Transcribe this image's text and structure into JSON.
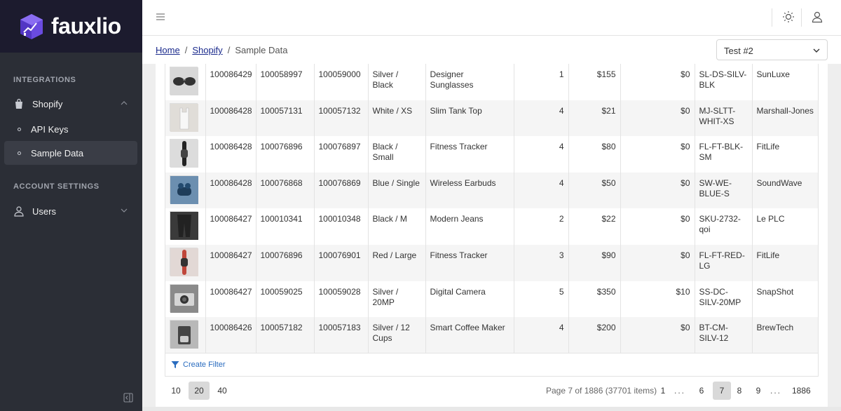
{
  "brand": {
    "name": "fauxlio"
  },
  "sidebar": {
    "section_integrations": "INTEGRATIONS",
    "shopify_label": "Shopify",
    "api_keys_label": "API Keys",
    "sample_data_label": "Sample Data",
    "section_account": "ACCOUNT SETTINGS",
    "users_label": "Users"
  },
  "breadcrumb": {
    "home": "Home",
    "shopify": "Shopify",
    "current": "Sample Data",
    "sep": "/"
  },
  "store_select": {
    "value": "Test #2"
  },
  "rows": [
    {
      "order": "100086429",
      "product": "100058997",
      "variant": "100059000",
      "option": "Silver / Black",
      "title": "Designer Sunglasses",
      "qty": "1",
      "price": "$155",
      "discount": "$0",
      "sku": "SL-DS-SILV-BLK",
      "vendor": "SunLuxe",
      "thumb_color": "#d8d8d8",
      "thumb": "sunglasses"
    },
    {
      "order": "100086428",
      "product": "100057131",
      "variant": "100057132",
      "option": "White / XS",
      "title": "Slim Tank Top",
      "qty": "4",
      "price": "$21",
      "discount": "$0",
      "sku": "MJ-SLTT-WHIT-XS",
      "vendor": "Marshall-Jones",
      "thumb_color": "#e0ddd8",
      "thumb": "tank"
    },
    {
      "order": "100086428",
      "product": "100076896",
      "variant": "100076897",
      "option": "Black / Small",
      "title": "Fitness Tracker",
      "qty": "4",
      "price": "$80",
      "discount": "$0",
      "sku": "FL-FT-BLK-SM",
      "vendor": "FitLife",
      "thumb_color": "#dcdcdc",
      "thumb": "tracker-black"
    },
    {
      "order": "100086428",
      "product": "100076868",
      "variant": "100076869",
      "option": "Blue / Single",
      "title": "Wireless Earbuds",
      "qty": "4",
      "price": "$50",
      "discount": "$0",
      "sku": "SW-WE-BLUE-S",
      "vendor": "SoundWave",
      "thumb_color": "#6c8fb0",
      "thumb": "earbuds"
    },
    {
      "order": "100086427",
      "product": "100010341",
      "variant": "100010348",
      "option": "Black / M",
      "title": "Modern Jeans",
      "qty": "2",
      "price": "$22",
      "discount": "$0",
      "sku": "SKU-2732-qoi",
      "vendor": "Le PLC",
      "thumb_color": "#3a3a3a",
      "thumb": "jeans"
    },
    {
      "order": "100086427",
      "product": "100076896",
      "variant": "100076901",
      "option": "Red / Large",
      "title": "Fitness Tracker",
      "qty": "3",
      "price": "$90",
      "discount": "$0",
      "sku": "FL-FT-RED-LG",
      "vendor": "FitLife",
      "thumb_color": "#e2d8d5",
      "thumb": "tracker-red"
    },
    {
      "order": "100086427",
      "product": "100059025",
      "variant": "100059028",
      "option": "Silver / 20MP",
      "title": "Digital Camera",
      "qty": "5",
      "price": "$350",
      "discount": "$10",
      "sku": "SS-DC-SILV-20MP",
      "vendor": "SnapShot",
      "thumb_color": "#8a8a8a",
      "thumb": "camera"
    },
    {
      "order": "100086426",
      "product": "100057182",
      "variant": "100057183",
      "option": "Silver / 12 Cups",
      "title": "Smart Coffee Maker",
      "qty": "4",
      "price": "$200",
      "discount": "$0",
      "sku": "BT-CM-SILV-12",
      "vendor": "BrewTech",
      "thumb_color": "#b8b8b8",
      "thumb": "coffee"
    }
  ],
  "filter": {
    "label": "Create Filter"
  },
  "pager": {
    "sizes": [
      "10",
      "20",
      "40"
    ],
    "active_size": "20",
    "info": "Page 7 of 1886 (37701 items)",
    "pages": [
      "1",
      "6",
      "7",
      "8",
      "9",
      "1886"
    ],
    "active_page": "7",
    "dots": "..."
  }
}
